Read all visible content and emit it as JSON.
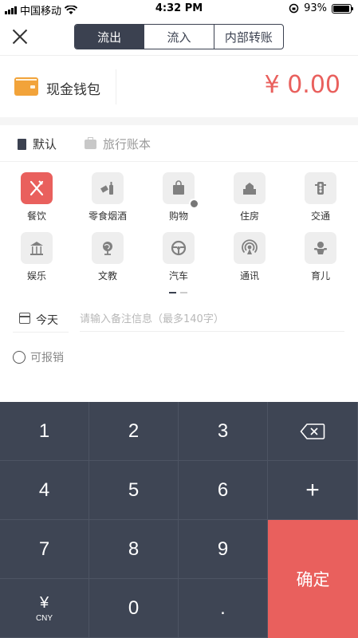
{
  "status_bar": {
    "carrier": "中国移动",
    "time": "4:32 PM",
    "battery": "93%",
    "battery_level": 0.93
  },
  "nav": {
    "tabs": [
      "流出",
      "流入",
      "内部转账"
    ],
    "active_tab": "流出"
  },
  "wallet": {
    "name": "现金钱包",
    "amount": "¥ 0.00"
  },
  "books": {
    "tabs": [
      "默认",
      "旅行账本"
    ],
    "active": "默认"
  },
  "categories": [
    {
      "label": "餐饮",
      "icon": "fork-knife-icon",
      "active": true
    },
    {
      "label": "零食烟酒",
      "icon": "snack-icon"
    },
    {
      "label": "购物",
      "icon": "shopping-bag-icon"
    },
    {
      "label": "住房",
      "icon": "building-icon"
    },
    {
      "label": "交通",
      "icon": "traffic-light-icon"
    },
    {
      "label": "娱乐",
      "icon": "carousel-icon"
    },
    {
      "label": "文教",
      "icon": "globe-icon"
    },
    {
      "label": "汽车",
      "icon": "steering-wheel-icon"
    },
    {
      "label": "通讯",
      "icon": "signal-icon"
    },
    {
      "label": "育儿",
      "icon": "baby-icon"
    }
  ],
  "date": {
    "label": "今天"
  },
  "note": {
    "placeholder": "请输入备注信息（最多140字）"
  },
  "reimbursable": {
    "label": "可报销"
  },
  "keypad": {
    "k1": "1",
    "k2": "2",
    "k3": "3",
    "k4": "4",
    "k5": "5",
    "k6": "6",
    "plus": "+",
    "k7": "7",
    "k8": "8",
    "k9": "9",
    "currency": "¥",
    "currency_code": "CNY",
    "k0": "0",
    "dot": ".",
    "confirm": "确定"
  },
  "colors": {
    "accent": "#e9605d",
    "dark": "#3e4554",
    "wallet": "#f2a33a"
  }
}
